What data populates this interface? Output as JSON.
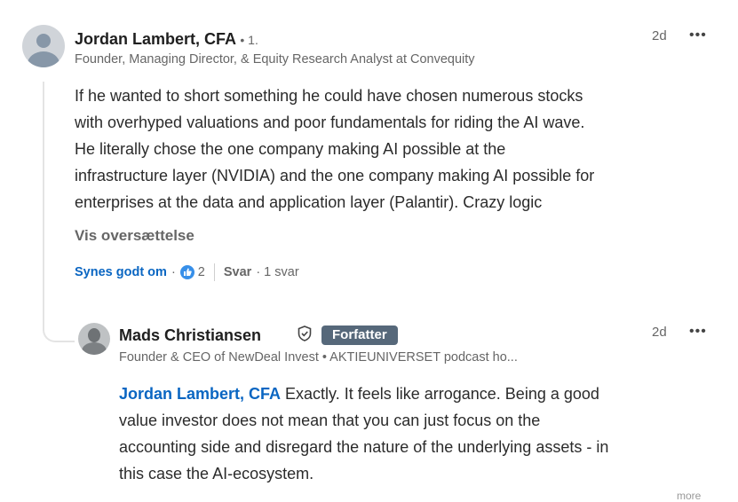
{
  "comment": {
    "author": "Jordan Lambert, CFA",
    "degree": "• 1.",
    "headline": "Founder, Managing Director, & Equity Research Analyst at Convequity",
    "time": "2d",
    "more": "•••",
    "lines": [
      "If he wanted to short something he could have chosen numerous stocks",
      "with overhyped valuations and poor fundamentals for riding the AI wave.",
      "He literally chose the one company making AI possible at the",
      "infrastructure layer (NVIDIA) and the one company making AI possible for",
      "enterprises at the data and application layer (Palantir). Crazy logic"
    ],
    "translate": "Vis oversættelse",
    "like": "Synes godt om",
    "dot": "·",
    "reaction_count": "2",
    "reply": "Svar",
    "replies": "· 1 svar"
  },
  "reply_comment": {
    "author": "Mads Christiansen",
    "badge": "Forfatter",
    "headline": "Founder & CEO of NewDeal Invest • AKTIEUNIVERSET podcast ho...",
    "time": "2d",
    "more": "•••",
    "mention": "Jordan Lambert, CFA",
    "line1_rest": " Exactly. It feels like arrogance. Being a good",
    "lines": [
      "value investor does not mean that you can just focus on the",
      "accounting side and disregard the nature of the underlying assets - in",
      "this case the AI-ecosystem."
    ],
    "cutoff": "more"
  },
  "colors": {
    "accent": "#0a66c2",
    "badge": "#56687a",
    "like": "#378fe9"
  }
}
